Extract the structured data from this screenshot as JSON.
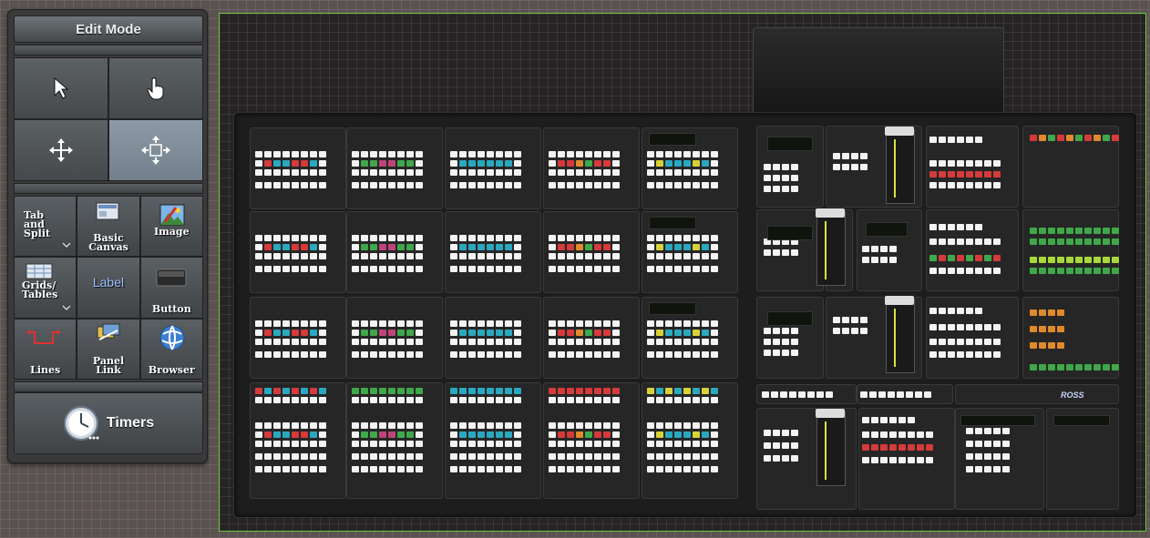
{
  "palette": {
    "title": "Edit Mode",
    "modes": [
      {
        "name": "select",
        "icon": "arrow-pointer-icon",
        "active": false
      },
      {
        "name": "operate",
        "icon": "hand-pointer-icon",
        "active": false
      },
      {
        "name": "move",
        "icon": "move-arrows-icon",
        "active": false
      },
      {
        "name": "resize",
        "icon": "resize-box-icon",
        "active": true
      }
    ],
    "widgets": [
      {
        "label": "Tab\nand\nSplit",
        "icon": "tab-split-icon"
      },
      {
        "label": "Basic\nCanvas",
        "icon": "canvas-icon"
      },
      {
        "label": "Image",
        "icon": "image-icon"
      },
      {
        "label": "Grids/\nTables",
        "icon": "grid-table-icon"
      },
      {
        "label": "Label",
        "icon": "label-icon"
      },
      {
        "label": "Button",
        "icon": "button-icon"
      },
      {
        "label": "Lines",
        "icon": "lines-icon"
      },
      {
        "label": "Panel\nLink",
        "icon": "panel-link-icon"
      },
      {
        "label": "Browser",
        "icon": "globe-icon"
      }
    ],
    "timers_label": "Timers"
  },
  "canvas": {
    "border_color": "#6ac53c",
    "panel_brand": "ROSS"
  },
  "colors": {
    "button_white": "#f3f3f3",
    "button_red": "#d63a3a",
    "button_teal": "#2aa8c0",
    "button_green": "#3fa84a",
    "button_pink": "#c0447a",
    "button_orange": "#e08a2c",
    "button_yellow": "#d8d23a",
    "button_lime": "#a8d83a"
  }
}
